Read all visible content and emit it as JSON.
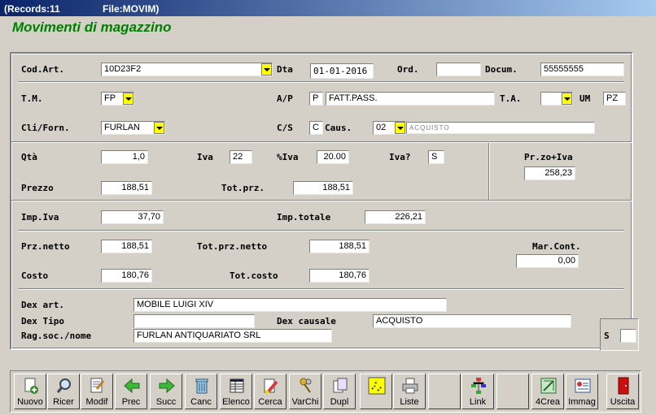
{
  "titlebar": {
    "records": "(Records:11",
    "file": "File:MOVIM)"
  },
  "heading": "Movimenti di magazzino",
  "labels": {
    "cod_art": "Cod.Art.",
    "dta": "Dta",
    "ord": "Ord.",
    "docum": "Docum.",
    "tm": "T.M.",
    "ap": "A/P",
    "ta": "T.A.",
    "um": "UM",
    "cli_forn": "Cli/Forn.",
    "cs": "C/S",
    "caus": "Caus.",
    "qta": "Qtà",
    "iva": "Iva",
    "piva": "%Iva",
    "iva_q": "Iva?",
    "przivа": "Pr.zo+Iva",
    "prezzo": "Prezzo",
    "tot_prz": "Tot.prz.",
    "imp_iva": "Imp.Iva",
    "imp_totale": "Imp.totale",
    "prz_netto": "Prz.netto",
    "tot_prz_netto": "Tot.prz.netto",
    "mar_cont": "Mar.Cont.",
    "costo": "Costo",
    "tot_costo": "Tot.costo",
    "dex_art": "Dex art.",
    "dex_tipo": "Dex Tipo",
    "dex_causale": "Dex causale",
    "rag_soc": "Rag.soc./nome",
    "s": "S"
  },
  "fields": {
    "cod_art": "10D23F2",
    "dta": "01-01-2016",
    "ord": "",
    "docum": "55555555",
    "tm": "FP",
    "ap": "P",
    "ap_desc": "FATT.PASS.",
    "ta": "",
    "um": "PZ",
    "cli_forn": "FURLAN",
    "cs": "C",
    "caus": "02",
    "caus_desc": "ACQUISTO",
    "qta": "1,0",
    "iva": "22",
    "piva": "20.00",
    "iva_q": "S",
    "przivа": "258,23",
    "prezzo": "188,51",
    "tot_prz": "188,51",
    "imp_iva": "37,70",
    "imp_totale": "226,21",
    "prz_netto": "188,51",
    "tot_prz_netto": "188,51",
    "mar_cont": "0,00",
    "costo": "180,76",
    "tot_costo": "180,76",
    "dex_art": "MOBILE LUIGI XIV",
    "dex_tipo": "",
    "dex_causale": "ACQUISTO",
    "rag_soc": "FURLAN ANTIQUARIATO SRL",
    "s": ""
  },
  "toolbar": [
    {
      "id": "nuovo",
      "label": "Nuovo",
      "icon": "new-doc-icon"
    },
    {
      "id": "ricer",
      "label": "Ricer",
      "icon": "magnifier-icon"
    },
    {
      "id": "modif",
      "label": "Modif",
      "icon": "edit-doc-icon"
    },
    {
      "id": "prec",
      "label": "Prec",
      "icon": "arrow-left-icon"
    },
    {
      "id": "succ",
      "label": "Succ",
      "icon": "arrow-right-icon"
    },
    {
      "id": "canc",
      "label": "Canc",
      "icon": "trash-icon"
    },
    {
      "id": "elenco",
      "label": "Elenco",
      "icon": "table-icon"
    },
    {
      "id": "cerca",
      "label": "Cerca",
      "icon": "highlighter-icon"
    },
    {
      "id": "varchi",
      "label": "VarChi",
      "icon": "keys-icon"
    },
    {
      "id": "dupl",
      "label": "Dupl",
      "icon": "duplicate-icon"
    },
    {
      "id": "flag",
      "label": "",
      "icon": "yellow-checks-icon"
    },
    {
      "id": "liste",
      "label": "Liste",
      "icon": "printer-icon"
    },
    {
      "id": "blank1",
      "label": "",
      "icon": ""
    },
    {
      "id": "link",
      "label": "Link",
      "icon": "link-tree-icon"
    },
    {
      "id": "blank2",
      "label": "",
      "icon": ""
    },
    {
      "id": "4crea",
      "label": "4Crea",
      "icon": "create-icon"
    },
    {
      "id": "immag",
      "label": "Immag",
      "icon": "image-card-icon"
    },
    {
      "id": "uscita",
      "label": "Uscita",
      "icon": "exit-door-icon"
    }
  ]
}
